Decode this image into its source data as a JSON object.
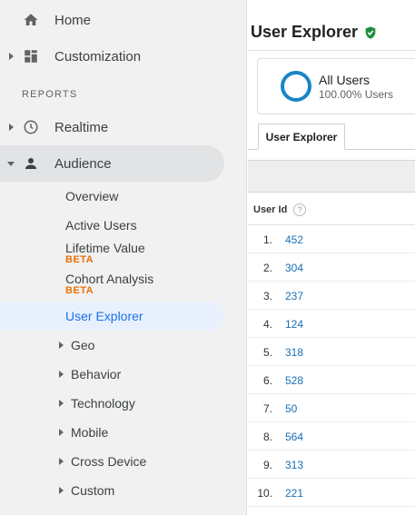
{
  "sidebar": {
    "home_label": "Home",
    "customization_label": "Customization",
    "reports_header": "REPORTS",
    "realtime_label": "Realtime",
    "audience_label": "Audience",
    "audience_items": {
      "overview": "Overview",
      "active_users": "Active Users",
      "lifetime_value": "Lifetime Value",
      "lifetime_value_badge": "BETA",
      "cohort_analysis": "Cohort Analysis",
      "cohort_analysis_badge": "BETA",
      "user_explorer": "User Explorer"
    },
    "groups": [
      "Geo",
      "Behavior",
      "Technology",
      "Mobile",
      "Cross Device",
      "Custom"
    ]
  },
  "main": {
    "title": "User Explorer",
    "segment": {
      "name": "All Users",
      "percent": "100.00% Users"
    },
    "tab_label": "User Explorer",
    "table": {
      "column_header": "User Id",
      "help_glyph": "?",
      "rows": [
        {
          "num": "1.",
          "id": "452"
        },
        {
          "num": "2.",
          "id": "304"
        },
        {
          "num": "3.",
          "id": "237"
        },
        {
          "num": "4.",
          "id": "124"
        },
        {
          "num": "5.",
          "id": "318"
        },
        {
          "num": "6.",
          "id": "528"
        },
        {
          "num": "7.",
          "id": "50"
        },
        {
          "num": "8.",
          "id": "564"
        },
        {
          "num": "9.",
          "id": "313"
        },
        {
          "num": "10.",
          "id": "221"
        }
      ]
    }
  },
  "colors": {
    "accent": "#1a73e8",
    "beta": "#e8710a",
    "verified": "#1e8e3e",
    "link": "#1a6fb5"
  }
}
